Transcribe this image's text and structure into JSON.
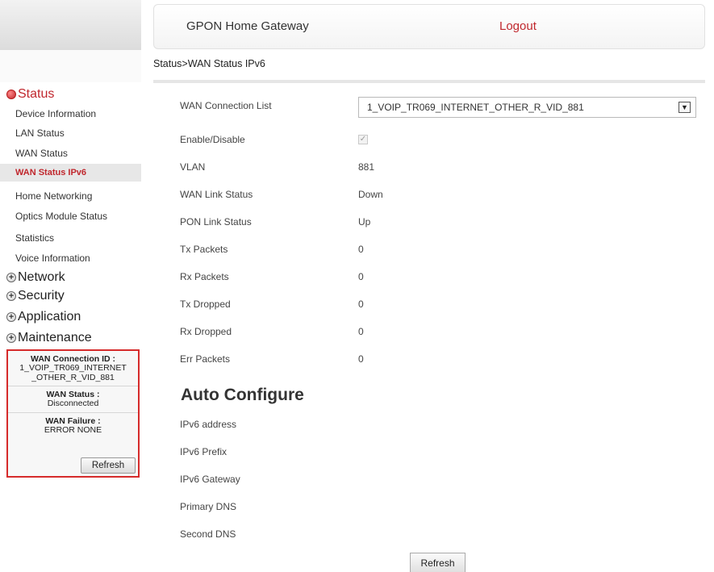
{
  "header": {
    "title": "GPON Home Gateway",
    "logout": "Logout"
  },
  "breadcrumb": "Status>WAN Status IPv6",
  "sidebar": {
    "categories": [
      {
        "label": "Status",
        "expanded": true,
        "icon": "status-icon"
      },
      {
        "label": "Network",
        "expanded": false,
        "icon": "plus-icon"
      },
      {
        "label": "Security",
        "expanded": false,
        "icon": "plus-icon"
      },
      {
        "label": "Application",
        "expanded": false,
        "icon": "plus-icon"
      },
      {
        "label": "Maintenance",
        "expanded": false,
        "icon": "plus-icon"
      }
    ],
    "status_items": [
      "Device Information",
      "LAN Status",
      "WAN Status",
      "WAN Status IPv6",
      "Home Networking",
      "Optics Module Status",
      "Statistics",
      "Voice Information"
    ],
    "active_item": "WAN Status IPv6",
    "info": {
      "conn_id_label": "WAN Connection ID :",
      "conn_id_value_1": "1_VOIP_TR069_INTERNET",
      "conn_id_value_2": "_OTHER_R_VID_881",
      "wan_status_label": "WAN Status :",
      "wan_status_value": "Disconnected",
      "wan_failure_label": "WAN Failure :",
      "wan_failure_value": "ERROR NONE",
      "refresh": "Refresh"
    }
  },
  "form": {
    "connection_list_label": "WAN Connection List",
    "connection_list_value": "1_VOIP_TR069_INTERNET_OTHER_R_VID_881",
    "enable_label": "Enable/Disable",
    "enable_checked": true,
    "vlan_label": "VLAN",
    "vlan_value": "881",
    "wan_link_label": "WAN Link Status",
    "wan_link_value": "Down",
    "pon_link_label": "PON Link Status",
    "pon_link_value": "Up",
    "tx_packets_label": "Tx Packets",
    "tx_packets_value": "0",
    "rx_packets_label": "Rx Packets",
    "rx_packets_value": "0",
    "tx_dropped_label": "Tx Dropped",
    "tx_dropped_value": "0",
    "rx_dropped_label": "Rx Dropped",
    "rx_dropped_value": "0",
    "err_packets_label": "Err Packets",
    "err_packets_value": "0"
  },
  "auto_configure": {
    "title": "Auto Configure",
    "ipv6_address_label": "IPv6 address",
    "ipv6_prefix_label": "IPv6 Prefix",
    "ipv6_gateway_label": "IPv6 Gateway",
    "primary_dns_label": "Primary DNS",
    "second_dns_label": "Second DNS"
  },
  "refresh_button": "Refresh",
  "colors": {
    "accent": "#c0272d",
    "info_border": "#d62b2b"
  }
}
